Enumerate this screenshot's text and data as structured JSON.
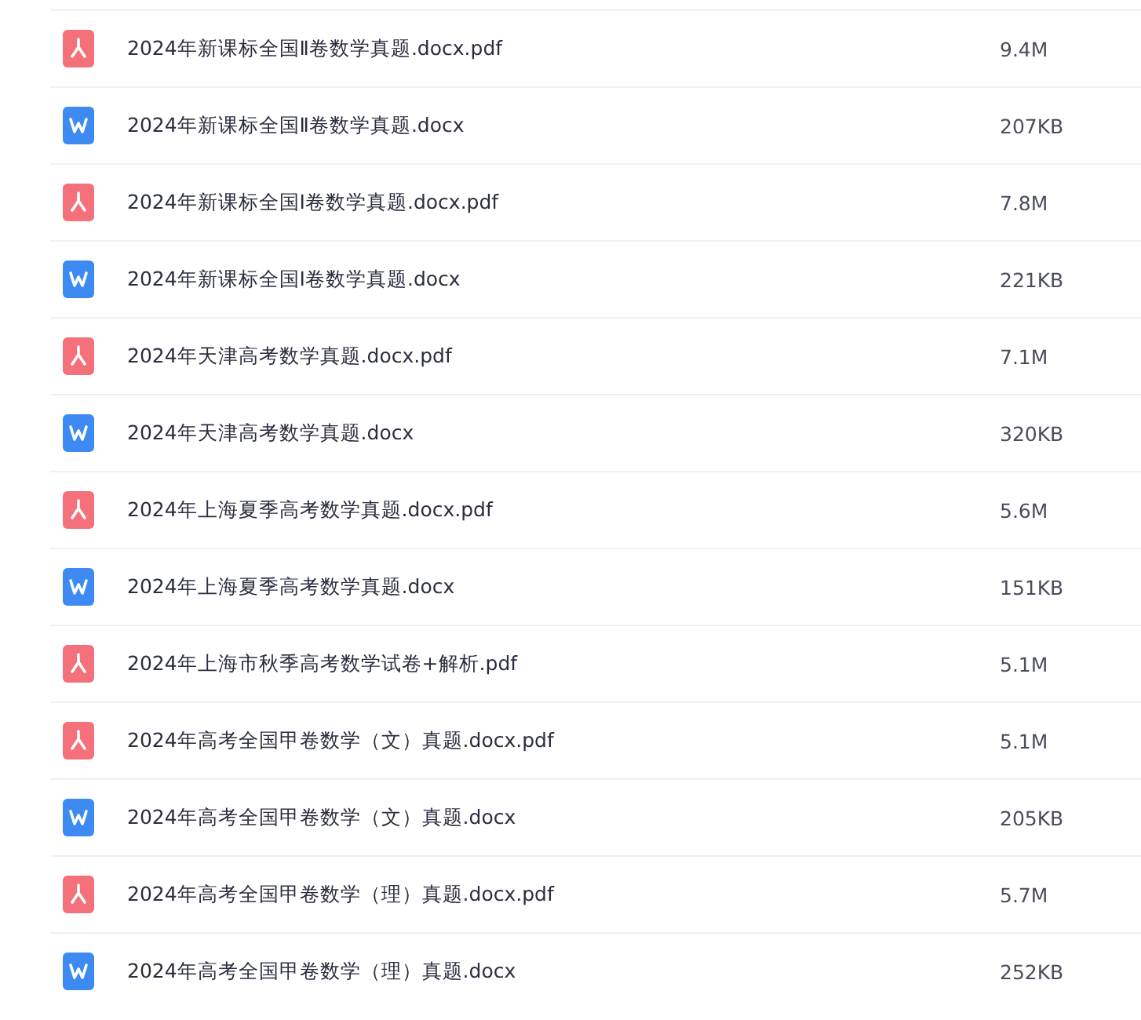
{
  "files": [
    {
      "kind": "pdf",
      "name": "2024年新课标全国Ⅱ卷数学真题.docx.pdf",
      "size": "9.4M"
    },
    {
      "kind": "docx",
      "name": "2024年新课标全国Ⅱ卷数学真题.docx",
      "size": "207KB"
    },
    {
      "kind": "pdf",
      "name": "2024年新课标全国Ⅰ卷数学真题.docx.pdf",
      "size": "7.8M"
    },
    {
      "kind": "docx",
      "name": "2024年新课标全国Ⅰ卷数学真题.docx",
      "size": "221KB"
    },
    {
      "kind": "pdf",
      "name": "2024年天津高考数学真题.docx.pdf",
      "size": "7.1M"
    },
    {
      "kind": "docx",
      "name": "2024年天津高考数学真题.docx",
      "size": "320KB"
    },
    {
      "kind": "pdf",
      "name": "2024年上海夏季高考数学真题.docx.pdf",
      "size": "5.6M"
    },
    {
      "kind": "docx",
      "name": "2024年上海夏季高考数学真题.docx",
      "size": "151KB"
    },
    {
      "kind": "pdf",
      "name": "2024年上海市秋季高考数学试卷+解析.pdf",
      "size": "5.1M"
    },
    {
      "kind": "pdf",
      "name": "2024年高考全国甲卷数学（文）真题.docx.pdf",
      "size": "5.1M"
    },
    {
      "kind": "docx",
      "name": "2024年高考全国甲卷数学（文）真题.docx",
      "size": "205KB"
    },
    {
      "kind": "pdf",
      "name": "2024年高考全国甲卷数学（理）真题.docx.pdf",
      "size": "5.7M"
    },
    {
      "kind": "docx",
      "name": "2024年高考全国甲卷数学（理）真题.docx",
      "size": "252KB"
    }
  ]
}
